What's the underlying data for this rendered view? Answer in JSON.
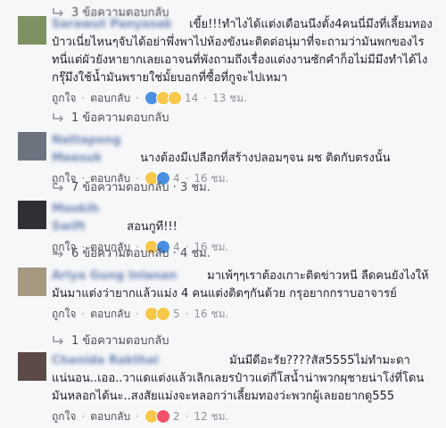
{
  "top_reply": {
    "label": "3 ข้อความตอบกลับ"
  },
  "comments": [
    {
      "name": "Sarawut Panyasak",
      "text": "เขี้ย!!!ทำไงได้แต่งเดือนนึงตั้ง4คนนี่มึงที่เลี้ยมทองป๋าวเนี่ยไหนๆจับได้อย่าพึ่งพาไปห้องขังนะติดต่อนุ่มาที่จะถามว่ามันพกของไรทนี่แต่ผัวยังหายากเลยเอาจนที่พังถามถึงเรื่องแต่งงานซักคำก็อไม่มีมึงทำได้ไงกรุ๊มึงใช้น้ำมันพรายใช่มั้ยบอกที่ซื้อที่กูจะไปเหมา",
      "like_label": "ถูกใจ",
      "reply_label": "ตอบกลับ",
      "reactions": [
        "like",
        "haha",
        "wow"
      ],
      "reaction_count": "14",
      "time": "13 ชม.",
      "replies_label": "1 ข้อความตอบกลับ"
    },
    {
      "name": "Nattapong Meesuk",
      "text": "นางต้องมีเปลือกที่สร้างปลอมๆจน ผช ติดกับตรงนั้น",
      "like_label": "ถูกใจ",
      "reply_label": "ตอบกลับ",
      "reactions": [
        "haha",
        "like"
      ],
      "reaction_count": "4",
      "time": "16 ชม.",
      "replies_label": "7 ข้อความตอบกลับ · 3 ชม."
    },
    {
      "name": "Mookih Swift",
      "text": "สอนกูที!!!",
      "like_label": "ถูกใจ",
      "reply_label": "ตอบกลับ",
      "reactions": [
        "haha",
        "like"
      ],
      "reaction_count": "4",
      "time": "16 ชม.",
      "replies_label": "6 ข้อความตอบกลับ · 4 ชม."
    },
    {
      "name": "Ariya Gung Inlanan",
      "text": "มาเพ้ๆๆเราต้องเกาะติดข่าวหนี ลืดคนยังไงให้มันมาแต่งว่ายากแล้วแม่ง 4 คนแต่งติดๆกันด้วย กรุอยากกราบอาจารย์",
      "like_label": "ถูกใจ",
      "reply_label": "ตอบกลับ",
      "reactions": [
        "haha",
        "wow"
      ],
      "reaction_count": "5",
      "time": "16 ชม.",
      "replies_label": "1 ข้อความตอบกลับ"
    },
    {
      "name": "Chanida Rakthai",
      "text": "มันมีดีอะรัย????สัส5555ไม่ทำมะดาแน่นอน..เออ..วาแดแต่งแล้วเลิกเลยรป๋าวแต่กี่โสน้ำน่าพวกผุชายน่าโง่ที่โดนมันหลอกได้นะ..สงสัยแม่งจะหลอกว่าเลี้ยมทองว่ะพวกผู้เลยอยากดู555",
      "like_label": "ถูกใจ",
      "reply_label": "ตอบกลับ",
      "reactions": [
        "haha",
        "love"
      ],
      "reaction_count": "2",
      "time": "12 ชม."
    }
  ]
}
